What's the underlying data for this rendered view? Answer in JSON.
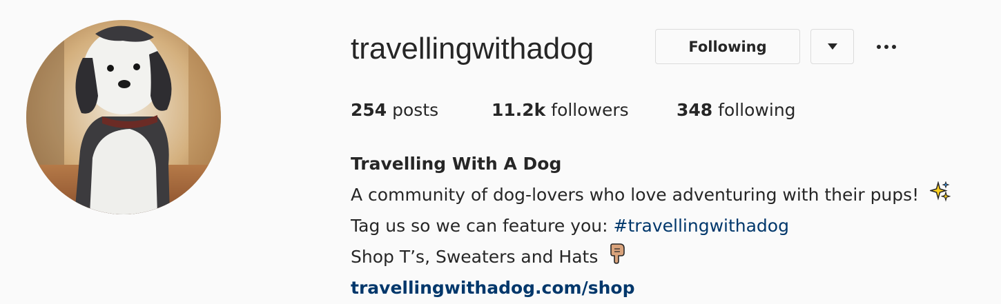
{
  "profile": {
    "username": "travellingwithadog",
    "following_button": "Following",
    "stats": {
      "posts_count": "254",
      "posts_label": "posts",
      "followers_count": "11.2k",
      "followers_label": "followers",
      "following_count": "348",
      "following_label": "following"
    },
    "bio": {
      "name": "Travelling With A Dog",
      "line1": "A community of dog-lovers who love adventuring with their pups!",
      "line2_prefix": "Tag us so we can feature you: ",
      "line2_hashtag": "#travellingwithadog",
      "line3": "Shop T’s, Sweaters and Hats",
      "link": "travellingwithadog.com/shop"
    },
    "icons": {
      "dropdown": "caret-down-icon",
      "more": "more-options-icon",
      "line1_emoji": "sparkles-emoji",
      "line3_emoji": "pointing-down-emoji"
    },
    "colors": {
      "link": "#00376b",
      "text": "#262626",
      "border": "#dbdbdb",
      "background": "#fafafa"
    }
  }
}
